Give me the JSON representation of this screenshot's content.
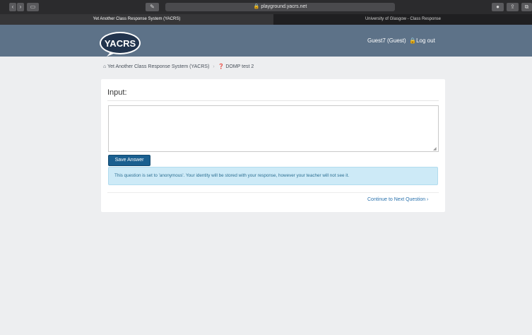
{
  "browser": {
    "address": "playground.yacrs.net",
    "lock_icon": "lock-icon",
    "tabs": [
      {
        "label": "Yet Another Class Response System (YACRS)",
        "active": true
      },
      {
        "label": "University of Glasgow - Class Response",
        "active": false
      }
    ]
  },
  "header": {
    "logo_text": "YACRS",
    "user_label": "Guest7 (Guest)",
    "logout_label": "Log out",
    "brand_color": "#5d7288"
  },
  "breadcrumb": {
    "home_label": "Yet Another Class Response System (YACRS)",
    "separator": "›",
    "current_label": "DOMP test 2"
  },
  "question": {
    "title": "Input:",
    "answer_value": "",
    "save_label": "Save Answer",
    "notice": "This question is set to 'anonymous'. Your identity will be stored with your response, however your teacher will not see it.",
    "next_label": "Continue to Next Question ›"
  }
}
